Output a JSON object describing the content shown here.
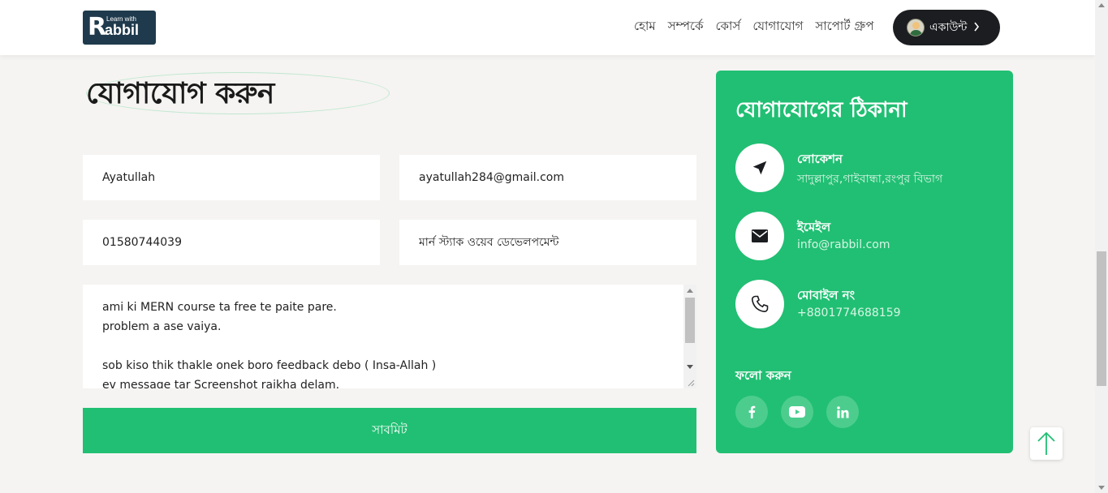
{
  "brand": {
    "line1": "Learn with",
    "line2": "abbil",
    "letter": "R"
  },
  "nav": {
    "links": [
      "হোম",
      "সম্পর্কে",
      "কোর্স",
      "যোগাযোগ",
      "সাপোর্ট গ্রুপ"
    ],
    "account_label": "একাউন্ট"
  },
  "page_title": "যোগাযোগ করুন",
  "form": {
    "name": "Ayatullah",
    "email": "ayatullah284@gmail.com",
    "phone": "01580744039",
    "subject": "মার্ন স্ট্যাক ওয়েব ডেভেলপমেন্ট",
    "message": "ami ki MERN course ta free te paite pare.\nproblem a ase vaiya.\n\nsob kiso thik thakle onek boro feedback debo ( Insa-Allah )\nev message tar Screenshot raikha delam.",
    "submit_label": "সাবমিট"
  },
  "contact": {
    "title": "যোগাযোগের ঠিকানা",
    "location": {
      "label": "লোকেশন",
      "value": "সাদুল্লাপুর,গাইবান্ধা,রংপুর বিভাগ"
    },
    "email": {
      "label": "ইমেইল",
      "value": "info@rabbil.com"
    },
    "mobile": {
      "label": "মোবাইল নং",
      "value": "+8801774688159"
    },
    "follow_label": "ফলো করুন",
    "social_icons": [
      "facebook-icon",
      "youtube-icon",
      "linkedin-icon"
    ]
  },
  "colors": {
    "accent": "#21bf73",
    "dark": "#1b1d20",
    "background": "#f5f4f2"
  }
}
